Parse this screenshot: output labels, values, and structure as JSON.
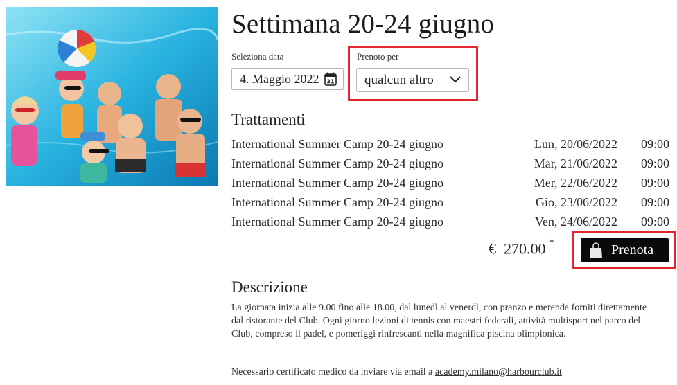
{
  "page": {
    "title": "Settimana 20-24 giugno"
  },
  "form": {
    "date_label": "Seleziona data",
    "date_value": "4. Maggio 2022",
    "booked_for_label": "Prenoto per",
    "booked_for_value": "qualcun altro"
  },
  "treatments": {
    "heading": "Trattamenti",
    "rows": [
      {
        "name": "International Summer Camp 20-24 giugno",
        "date": "Lun, 20/06/2022",
        "time": "09:00"
      },
      {
        "name": "International Summer Camp 20-24 giugno",
        "date": "Mar, 21/06/2022",
        "time": "09:00"
      },
      {
        "name": "International Summer Camp 20-24 giugno",
        "date": "Mer, 22/06/2022",
        "time": "09:00"
      },
      {
        "name": "International Summer Camp 20-24 giugno",
        "date": "Gio, 23/06/2022",
        "time": "09:00"
      },
      {
        "name": "International Summer Camp 20-24 giugno",
        "date": "Ven, 24/06/2022",
        "time": "09:00"
      }
    ]
  },
  "price": {
    "currency": "€",
    "amount": "270.00",
    "asterisk": "*"
  },
  "book_button": {
    "label": "Prenota",
    "icon": "shopping-bag-icon"
  },
  "description": {
    "heading": "Descrizione",
    "text": "La giornata inizia alle 9.00 fino alle 18.00, dal lunedì al venerdì, con pranzo e merenda forniti direttamente dal ristorante del Club. Ogni giorno lezioni di tennis con maestri federali, attività multisport nel parco del Club, compreso il padel, e pomeriggi rinfrescanti nella magnifica piscina olimpionica.",
    "certificate_text": "Necessario certificato medico da inviare via email a",
    "email": "academy.milano@harbourclub.it"
  },
  "colors": {
    "highlight": "#e3262e",
    "button_bg": "#0a0a0a"
  }
}
